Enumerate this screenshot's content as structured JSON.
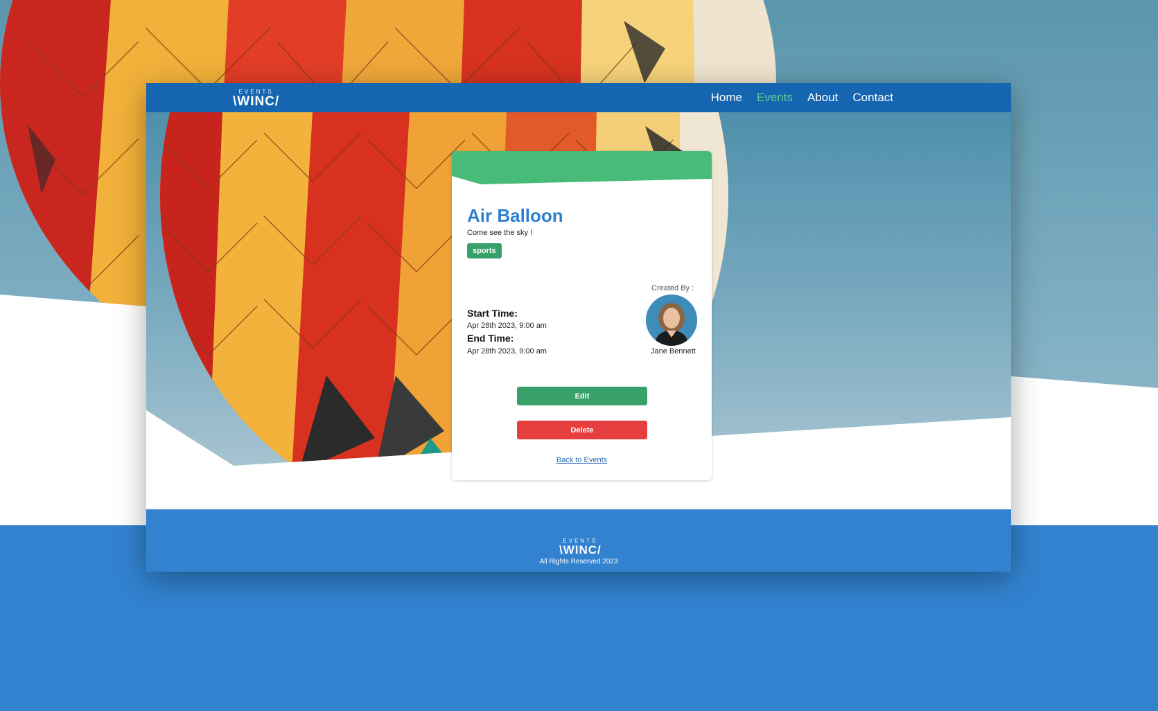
{
  "brand": {
    "logo_small": "EVENTS",
    "logo_big": "\\WINC/"
  },
  "nav": {
    "items": [
      {
        "label": "Home"
      },
      {
        "label": "Events",
        "active": true
      },
      {
        "label": "About"
      },
      {
        "label": "Contact"
      }
    ]
  },
  "event": {
    "title": "Air Balloon",
    "description": "Come see the sky !",
    "category": "sports",
    "start_label": "Start Time:",
    "start_value": "Apr 28th 2023, 9:00 am",
    "end_label": "End Time:",
    "end_value": "Apr 28th 2023, 9:00 am",
    "created_by_label": "Created By :",
    "creator_name": "Jane Bennett"
  },
  "actions": {
    "edit_label": "Edit",
    "delete_label": "Delete",
    "back_label": "Back to Events"
  },
  "footer": {
    "copyright": "All Rights Reserved 2023"
  },
  "colors": {
    "nav_bg": "#1565b0",
    "nav_active": "#5ad08e",
    "title": "#2f7fcf",
    "banner": "#48bb78",
    "edit": "#38a169",
    "delete": "#e53e3e",
    "footer_bg": "#3282cf"
  },
  "icons": {
    "hero_image": "hot-air-balloon-photo",
    "avatar": "user-avatar-photo"
  }
}
